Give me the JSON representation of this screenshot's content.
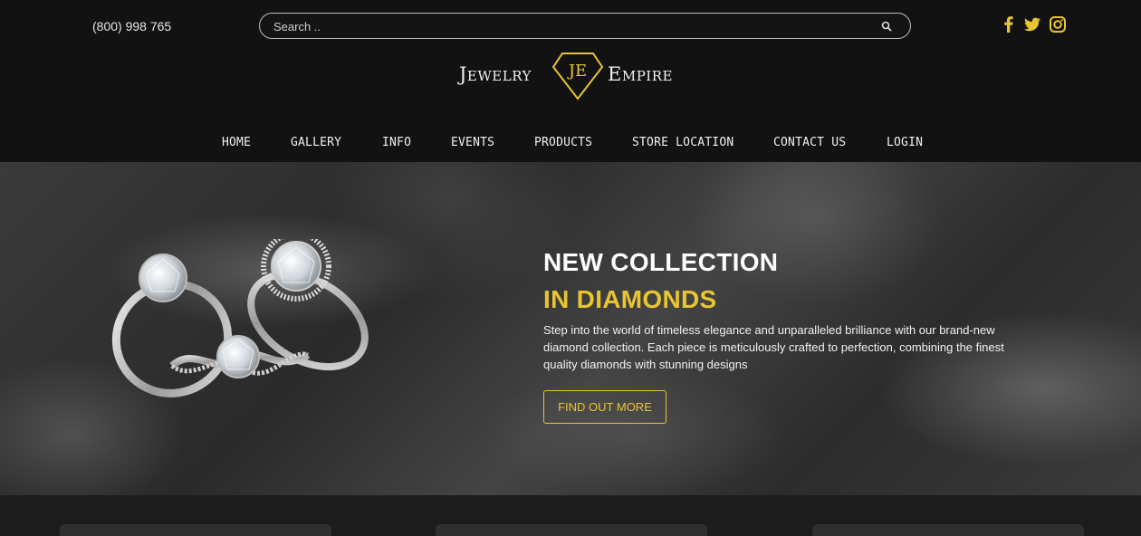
{
  "header": {
    "phone": "(800) 998 765",
    "search": {
      "placeholder": "Search ..",
      "icon": "search-icon"
    },
    "social": [
      {
        "name": "facebook-icon",
        "color": "#e8c531"
      },
      {
        "name": "twitter-icon",
        "color": "#e8c531"
      },
      {
        "name": "instagram-icon",
        "color": "#e8c531"
      }
    ],
    "logo": {
      "word_left": "Jewelry",
      "monogram": "JE",
      "word_right": "Empire"
    }
  },
  "nav": {
    "items": [
      {
        "label": "HOME"
      },
      {
        "label": "GALLERY"
      },
      {
        "label": "INFO"
      },
      {
        "label": "EVENTS"
      },
      {
        "label": "PRODUCTS"
      },
      {
        "label": "STORE LOCATION"
      },
      {
        "label": "CONTACT US"
      },
      {
        "label": "LOGIN"
      }
    ]
  },
  "hero": {
    "title_line1": "NEW COLLECTION",
    "title_line2": "IN DIAMONDS",
    "description": "Step into the world of timeless elegance and unparalleled brilliance with our brand-new diamond collection. Each piece is meticulously crafted to perfection, combining the finest quality diamonds with stunning designs",
    "cta_label": "FIND OUT MORE",
    "image": "diamond-rings-image"
  },
  "colors": {
    "accent": "#e8c531",
    "header_bg": "#121212",
    "page_bg": "#1c1c1c"
  }
}
